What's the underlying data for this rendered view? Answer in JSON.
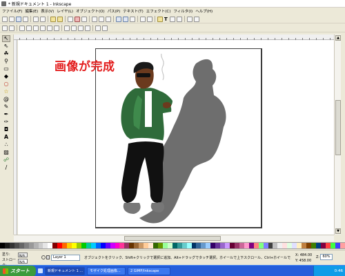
{
  "window": {
    "title": "* 新規ドキュメント 1 - Inkscape"
  },
  "menu": {
    "items": [
      "ファイル(F)",
      "編集(E)",
      "表示(V)",
      "レイヤ(L)",
      "オブジェクト(O)",
      "パス(P)",
      "テキスト(T)",
      "エフェクト(C)",
      "フィルタ(I)",
      "ヘルプ(H)"
    ]
  },
  "toolbar": {
    "text_tool_glyph": "T",
    "node_tool_glyph": "A"
  },
  "canvas": {
    "caption": "画像が完成"
  },
  "statusbar": {
    "fill_label": "塗り:",
    "stroke_label": "ストローク:",
    "fill_value": "N/A",
    "stroke_value": "N/A",
    "layer_name": "Layer 1",
    "message": "オブジェクトをクリック、Shift+クリックで選択に追加、Alt+ドラッグでタッチ選択。ホイールで上下スクロール、Ctrl+ホイールでズーム。",
    "coord_x": "X: 484.00",
    "coord_y": "Y: 458.00",
    "zoom_label": "Z:",
    "zoom_value": "60%"
  },
  "taskbar": {
    "start_label": "スタート",
    "tasks": [
      "新規ドキュメント 1 ...",
      "モザイク処理画像...",
      "2 GIMP/Inkscape"
    ],
    "clock": "0:46"
  },
  "colors": {
    "canvas_text": "#e31d1d",
    "jacket": "#2f6b3a",
    "shadow": "#6e6e6e",
    "taskbar": "#245edb",
    "start": "#3c9b3c"
  },
  "palette": [
    "#000000",
    "#1a1a1a",
    "#333333",
    "#4d4d4d",
    "#666666",
    "#808080",
    "#999999",
    "#b3b3b3",
    "#cccccc",
    "#e6e6e6",
    "#ffffff",
    "#800000",
    "#ff0000",
    "#ff6600",
    "#ffcc00",
    "#ffff00",
    "#99cc00",
    "#00cc00",
    "#00cc99",
    "#00ccff",
    "#0066ff",
    "#0000ff",
    "#6600ff",
    "#cc00ff",
    "#ff00cc",
    "#ff3399",
    "#993366",
    "#663300",
    "#996633",
    "#cc9966",
    "#ffcc99",
    "#ffe6cc",
    "#336600",
    "#669900",
    "#99ff99",
    "#ccffcc",
    "#006666",
    "#339999",
    "#66cccc",
    "#99ffff",
    "#003366",
    "#336699",
    "#6699cc",
    "#99ccff",
    "#330066",
    "#663399",
    "#9966cc",
    "#cc99ff",
    "#660033",
    "#993366",
    "#cc6699",
    "#ff99cc",
    "#800080",
    "#ff8080",
    "#80ff80",
    "#8080ff",
    "#404040",
    "#c0c0c0",
    "#f0f0f0",
    "#ffe0e0",
    "#e0ffe0",
    "#e0e0ff",
    "#fff0c0",
    "#c08040",
    "#804000",
    "#408000",
    "#004080",
    "#800040",
    "#ff4040",
    "#40ff40",
    "#4040ff",
    "#ffa0a0"
  ]
}
